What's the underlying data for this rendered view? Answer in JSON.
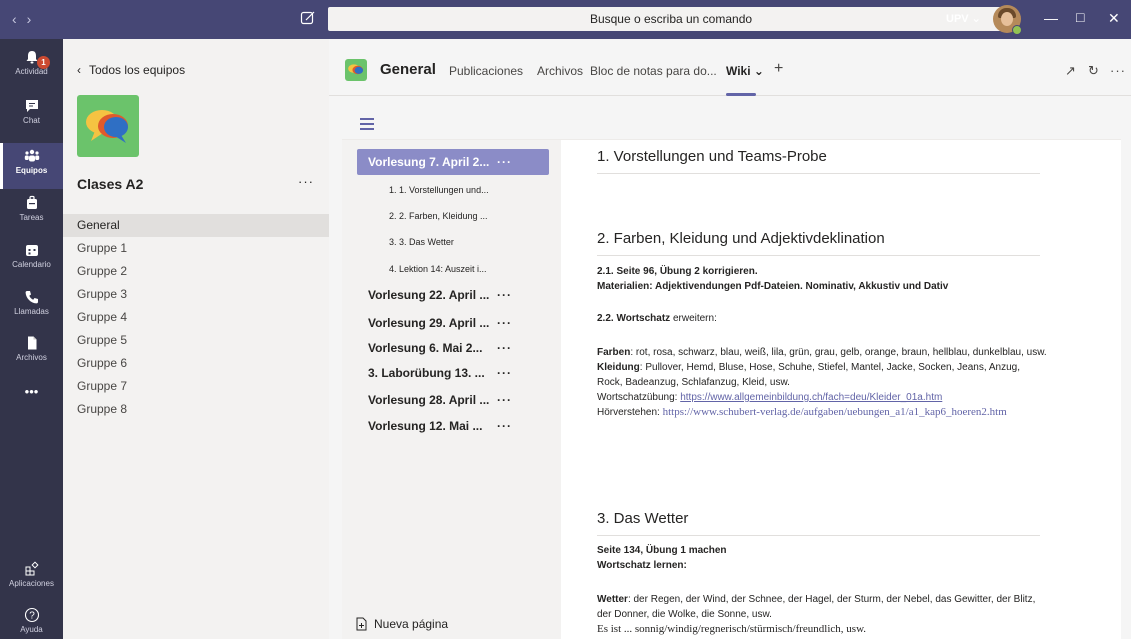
{
  "titlebar": {
    "nav_back_icon": "chevron-left-icon",
    "nav_forward_icon": "chevron-right-icon",
    "search_placeholder": "Busque o escriba un comando",
    "org_label": "UPV ⌄"
  },
  "rail": {
    "items": [
      {
        "label": "Actividad",
        "icon": "bell-icon",
        "badge": "1"
      },
      {
        "label": "Chat",
        "icon": "chat-icon"
      },
      {
        "label": "Equipos",
        "icon": "teams-icon",
        "active": true
      },
      {
        "label": "Tareas",
        "icon": "briefcase-icon"
      },
      {
        "label": "Calendario",
        "icon": "calendar-icon"
      },
      {
        "label": "Llamadas",
        "icon": "phone-icon"
      },
      {
        "label": "Archivos",
        "icon": "file-icon"
      },
      {
        "label": "•••",
        "icon": "more-icon"
      }
    ],
    "bottom": [
      {
        "label": "Aplicaciones",
        "icon": "apps-icon"
      },
      {
        "label": "Ayuda",
        "icon": "help-icon"
      }
    ]
  },
  "team_panel": {
    "back_label": "Todos los equipos",
    "team_name": "Clases A2",
    "more": "···",
    "channels": [
      "General",
      "Gruppe 1",
      "Gruppe 2",
      "Gruppe 3",
      "Gruppe 4",
      "Gruppe 5",
      "Gruppe 6",
      "Gruppe 7",
      "Gruppe 8"
    ]
  },
  "channel_header": {
    "title": "General",
    "tabs": [
      "Publicaciones",
      "Archivos",
      "Bloc de notas para do...",
      "Wiki ⌄",
      "+"
    ]
  },
  "wiki": {
    "pages": [
      {
        "label": "Vorlesung 7. April 2...",
        "active": true
      },
      {
        "label": "Vorlesung 22. April ..."
      },
      {
        "label": "Vorlesung 29. April ..."
      },
      {
        "label": "Vorlesung 6. Mai 2..."
      },
      {
        "label": "3. Laborübung 13. ..."
      },
      {
        "label": "Vorlesung 28. April ..."
      },
      {
        "label": "Vorlesung 12. Mai ..."
      }
    ],
    "sub_pages": [
      "1. 1. Vorstellungen und...",
      "2. 2. Farben, Kleidung ...",
      "3. 3. Das Wetter",
      "4. Lektion 14: Auszeit i..."
    ],
    "page_more": "···",
    "new_page": "Nueva página",
    "content": {
      "s1_title": "1. Vorstellungen und Teams-Probe",
      "s2_title": "2. Farben, Kleidung und Adjektivdeklination",
      "s2_p1_line1": "2.1. Seite 96, Übung 2 korrigieren.",
      "s2_p1_line2": "Materialien: Adjektivendungen Pdf-Dateien. Nominativ, Akkustiv und Dativ",
      "s2_p2_bold": "2.2. Wortschatz",
      "s2_p2_rest": " erweitern:",
      "farben_label": "Farben",
      "farben_text": ": rot, rosa, schwarz, blau, weiß, lila, grün, grau, gelb, orange, braun, hellblau, dunkelblau, usw.",
      "kleidung_label": "Kleidung",
      "kleidung_text": ": Pullover, Hemd, Bluse, Hose, Schuhe, Stiefel, Mantel, Jacke, Socken, Jeans, Anzug, Rock, Badeanzug, Schlafanzug, Kleid, usw.",
      "ws_label": "Wortschatzübung: ",
      "ws_link": "https://www.allgemeinbildung.ch/fach=deu/Kleider_01a.htm",
      "hv_label": "Hörverstehen: ",
      "hv_link": "https://www.schubert-verlag.de/aufgaben/uebungen_a1/a1_kap6_hoeren2.htm",
      "s3_title": "3. Das Wetter",
      "s3_p1_line1": "Seite 134, Übung 1 machen",
      "s3_p1_line2": "Wortschatz lernen:",
      "wetter_label": "Wetter",
      "wetter_text": ": der Regen, der Wind, der Schnee, der Hagel, der Sturm, der Nebel, das Gewitter, der Blitz, der Donner, die Wolke, die Sonne, usw.",
      "es_ist": "Es ist ... sonnig/windig/regnerisch/stürmisch/freundlich, usw."
    }
  },
  "colors": {
    "titlebar": "#464775",
    "rail": "#33344a",
    "accent": "#6264a7",
    "active_page": "#8b8cc7",
    "badge": "#cc4a31"
  }
}
